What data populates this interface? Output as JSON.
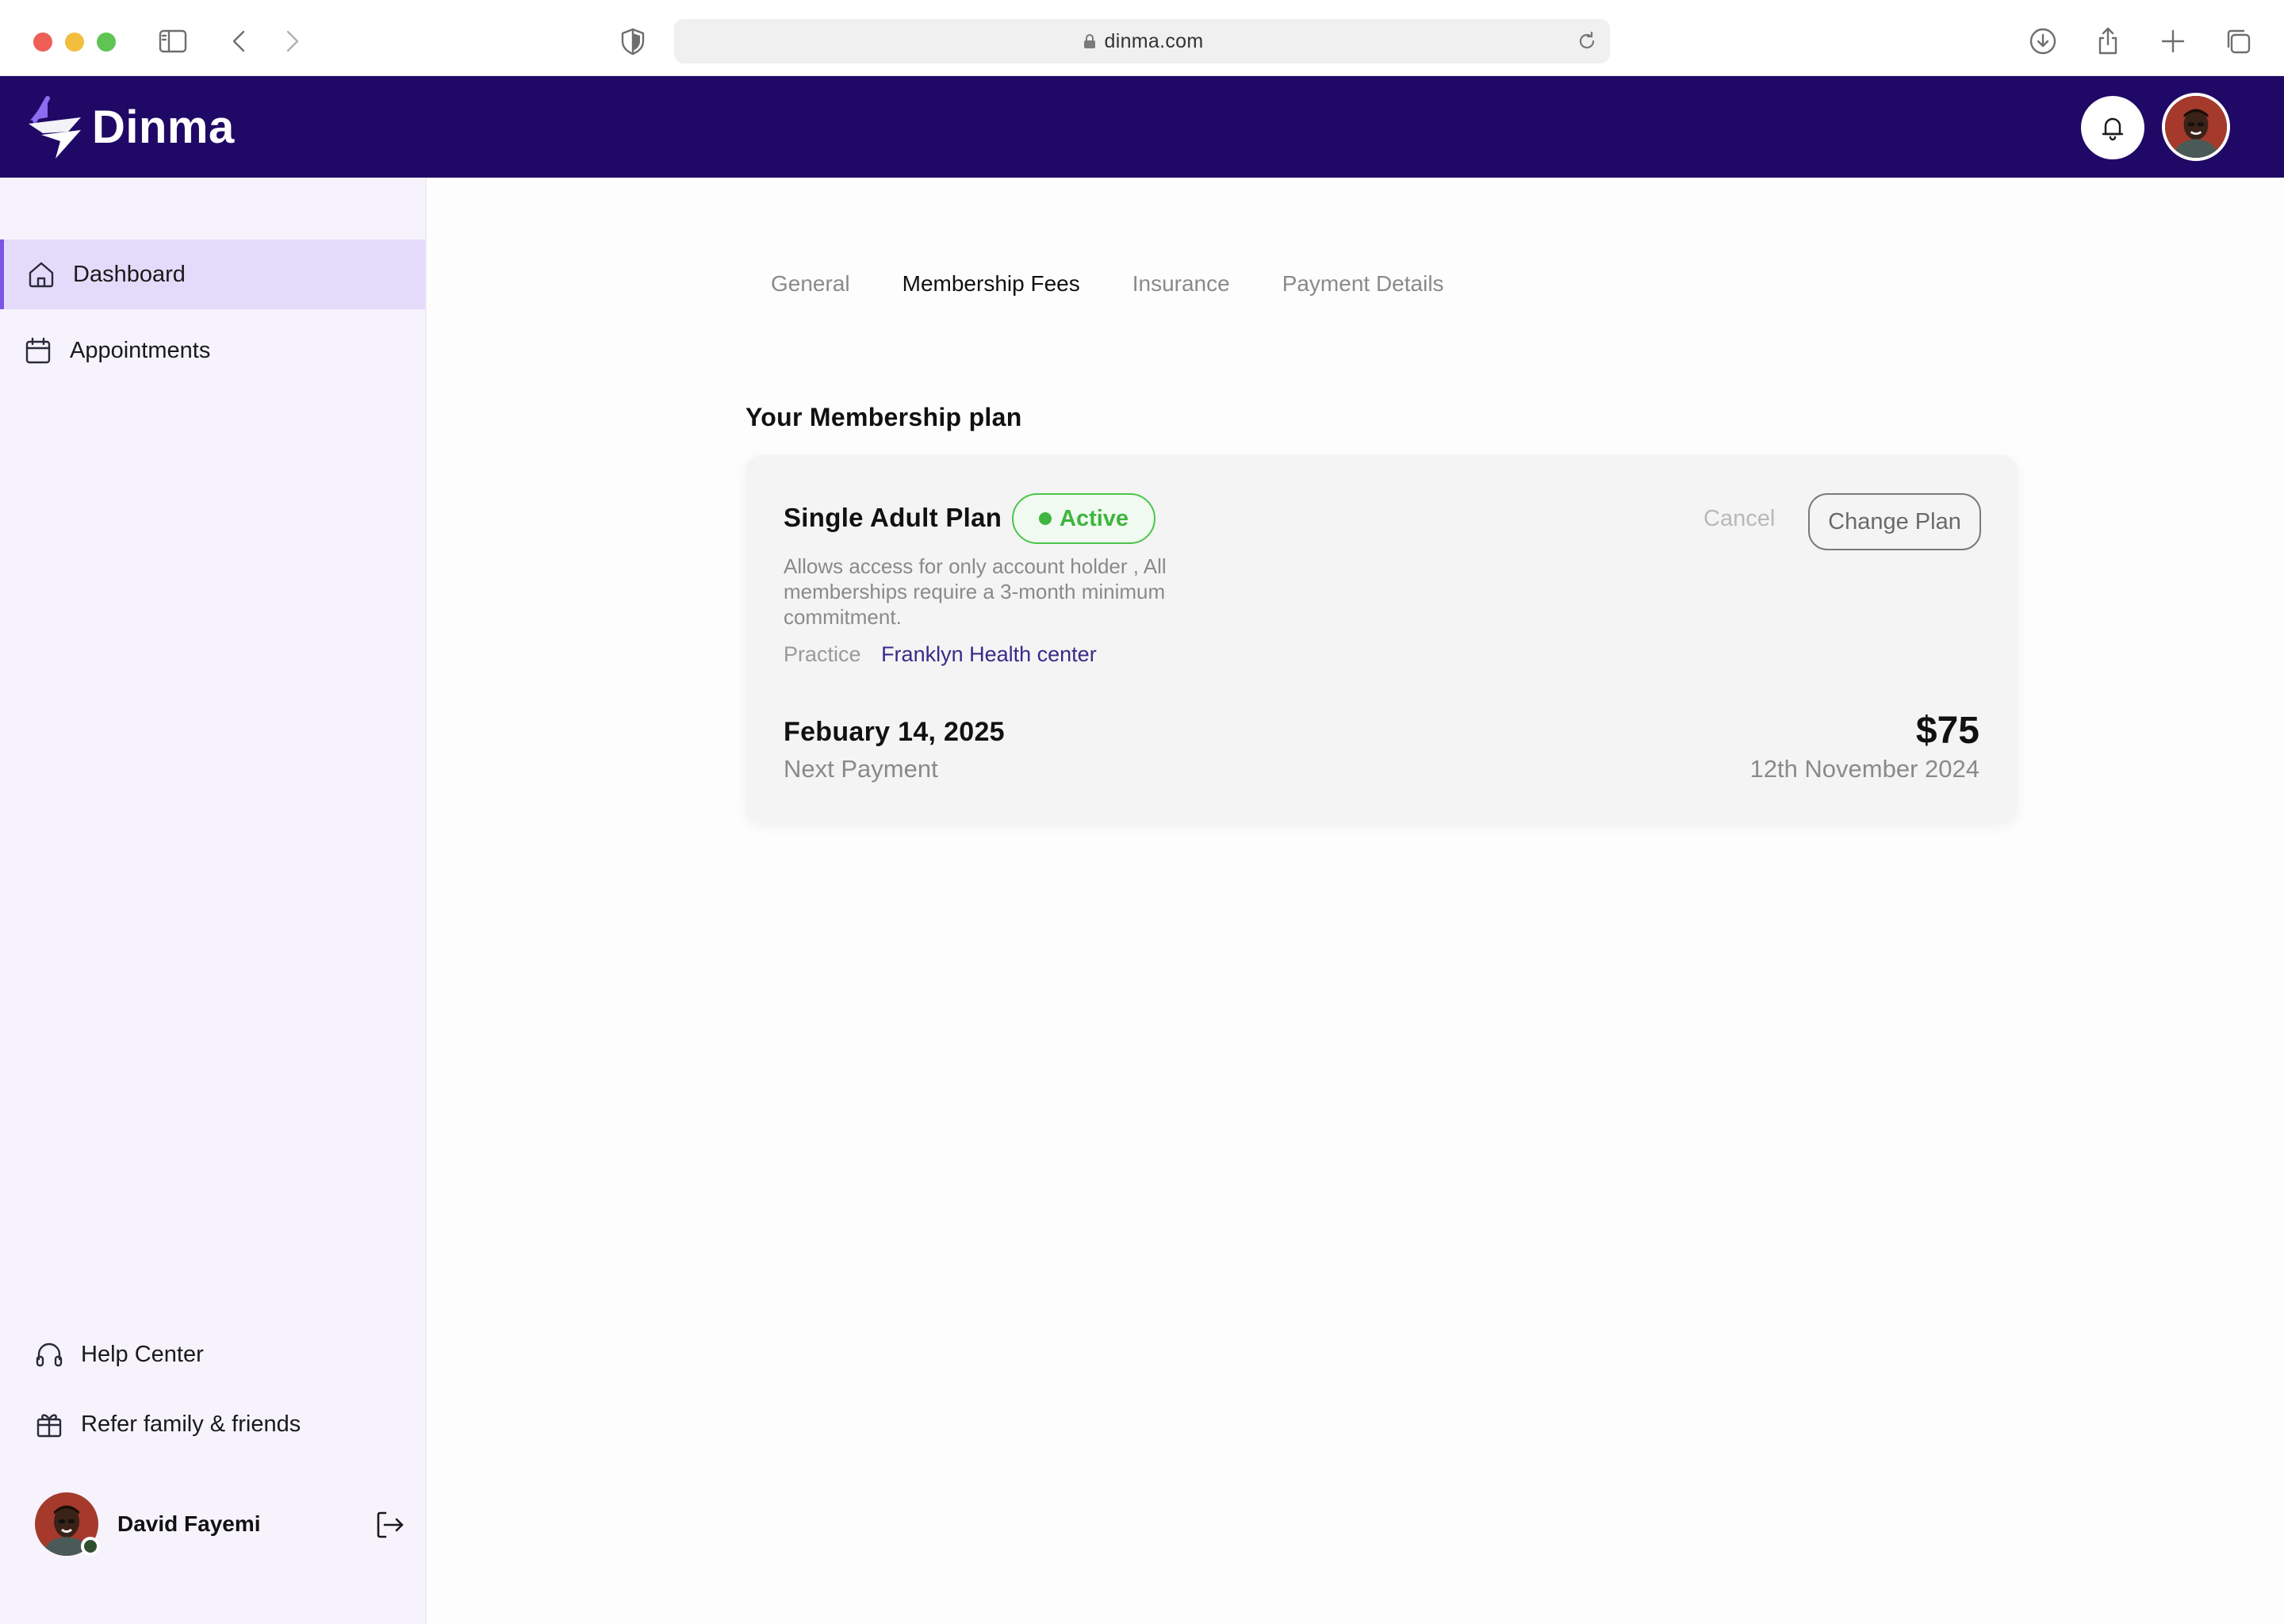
{
  "browser": {
    "url": "dinma.com"
  },
  "header": {
    "brand": "Dinma",
    "brand_color": "#200966"
  },
  "sidebar": {
    "nav": [
      {
        "label": "Dashboard",
        "icon": "home-icon",
        "active": true
      },
      {
        "label": "Appointments",
        "icon": "calendar-icon",
        "active": false
      }
    ],
    "footer_nav": [
      {
        "label": "Help Center",
        "icon": "headset-icon"
      },
      {
        "label": "Refer family & friends",
        "icon": "gift-icon"
      }
    ],
    "user": {
      "name": "David Fayemi",
      "status": "online"
    }
  },
  "main": {
    "tabs": [
      {
        "label": "General",
        "active": false
      },
      {
        "label": "Membership Fees",
        "active": true
      },
      {
        "label": "Insurance",
        "active": false
      },
      {
        "label": "Payment Details",
        "active": false
      }
    ],
    "section_title": "Your Membership plan",
    "plan": {
      "name": "Single Adult Plan",
      "status": "Active",
      "status_color": "#3eb53e",
      "description": "Allows access for only account holder , All memberships require a 3-month minimum commitment.",
      "practice_label": "Practice",
      "practice_value": "Franklyn Health center",
      "cancel_label": "Cancel",
      "change_label": "Change Plan",
      "next_payment_date": "Febuary 14, 2025",
      "next_payment_label": "Next Payment",
      "price": "$75",
      "price_date": "12th November 2024"
    }
  },
  "colors": {
    "accent": "#7c55e6",
    "sidebar_bg": "#f6f3fd",
    "active_nav_bg": "#e4dbfb"
  }
}
